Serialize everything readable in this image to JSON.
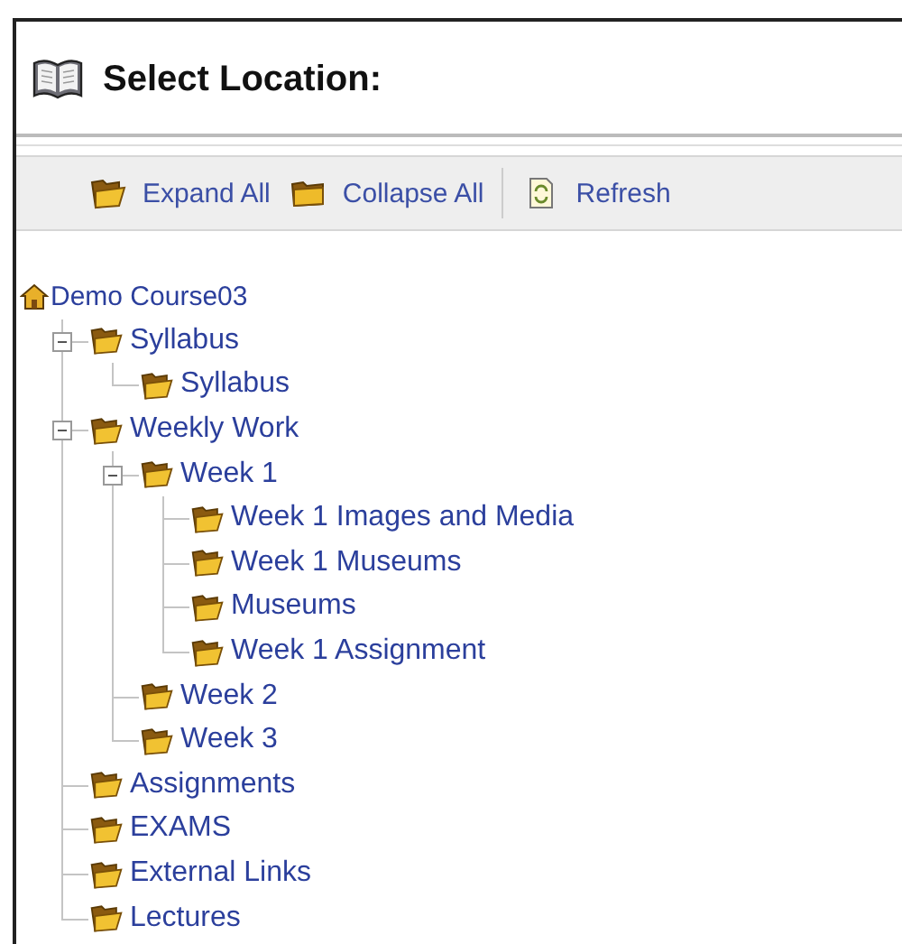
{
  "title": "Select Location:",
  "toolbar": [
    {
      "kind": "expand",
      "label": "Expand All"
    },
    {
      "kind": "collapse",
      "label": "Collapse All"
    },
    {
      "kind": "refresh",
      "label": "Refresh"
    }
  ],
  "tree": {
    "label": "Demo Course03",
    "children": [
      {
        "label": "Syllabus",
        "expanded": true,
        "children": [
          {
            "label": "Syllabus"
          }
        ]
      },
      {
        "label": "Weekly Work",
        "expanded": true,
        "children": [
          {
            "label": "Week 1",
            "expanded": true,
            "children": [
              {
                "label": "Week 1 Images and Media"
              },
              {
                "label": "Week 1 Museums"
              },
              {
                "label": "Museums"
              },
              {
                "label": "Week 1 Assignment"
              }
            ]
          },
          {
            "label": "Week 2"
          },
          {
            "label": "Week 3"
          }
        ]
      },
      {
        "label": "Assignments"
      },
      {
        "label": "EXAMS"
      },
      {
        "label": "External Links"
      },
      {
        "label": "Lectures"
      }
    ]
  }
}
